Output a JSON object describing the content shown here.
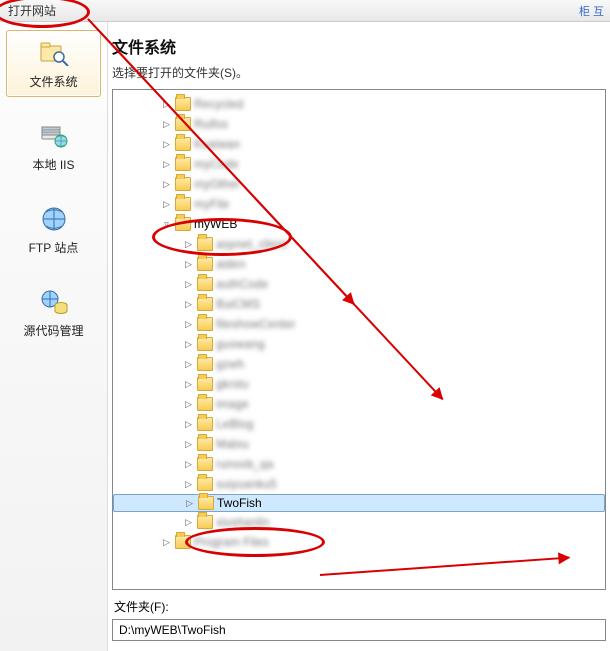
{
  "title": "打开网站",
  "title_right": "柜 互",
  "sidebar": {
    "items": [
      {
        "name": "file-system",
        "label": "文件系统",
        "icon": "folder-search-icon"
      },
      {
        "name": "local-iis",
        "label": "本地 IIS",
        "icon": "server-globe-icon"
      },
      {
        "name": "ftp-site",
        "label": "FTP 站点",
        "icon": "globe-icon"
      },
      {
        "name": "source-control",
        "label": "源代码管理",
        "icon": "globe-db-icon"
      }
    ]
  },
  "main": {
    "title": "文件系统",
    "subtitle": "选择要打开的文件夹(S)。"
  },
  "tree": {
    "level1": [
      {
        "label": "Recycled",
        "blur": true
      },
      {
        "label": "Ruifos",
        "blur": true
      },
      {
        "label": "Kuaiwan",
        "blur": true
      },
      {
        "label": "myCode",
        "blur": true
      },
      {
        "label": "myOther",
        "blur": true
      },
      {
        "label": "myFile",
        "blur": true
      }
    ],
    "myweb_label": "myWEB",
    "level2": [
      {
        "label": "aspnet_client",
        "blur": true
      },
      {
        "label": "aiden",
        "blur": true
      },
      {
        "label": "authCode",
        "blur": true
      },
      {
        "label": "BuiCMS",
        "blur": true
      },
      {
        "label": "fileshowCenter",
        "blur": true
      },
      {
        "label": "guowang",
        "blur": true
      },
      {
        "label": "gzwh",
        "blur": true
      },
      {
        "label": "gkrstu",
        "blur": true
      },
      {
        "label": "image",
        "blur": true
      },
      {
        "label": "LeBlog",
        "blur": true
      },
      {
        "label": "Malou",
        "blur": true
      },
      {
        "label": "runoob_qa",
        "blur": true
      },
      {
        "label": "suiyuanku5",
        "blur": true
      }
    ],
    "twofish_label": "TwoFish",
    "level2_after": [
      {
        "label": "xiushanlin",
        "blur": true
      }
    ],
    "level1_after": [
      {
        "label": "Program Files",
        "blur": true
      }
    ]
  },
  "footer": {
    "label": "文件夹(F):",
    "path": "D:\\myWEB\\TwoFish"
  },
  "annotations": {
    "color": "#d80000"
  }
}
